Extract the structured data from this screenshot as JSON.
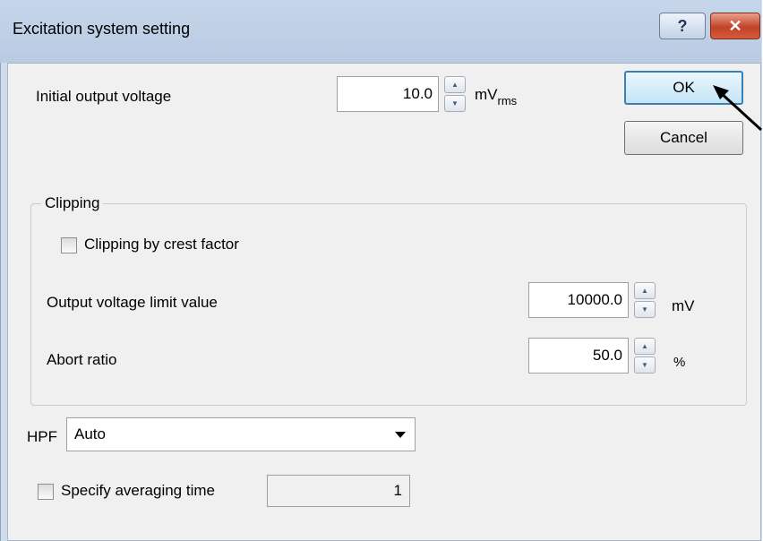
{
  "window": {
    "title": "Excitation system setting",
    "help_label": "?",
    "close_label": "✕"
  },
  "initial_output": {
    "label": "Initial output voltage",
    "value": "10.0",
    "unit_main": "mV",
    "unit_sub": "rms"
  },
  "buttons": {
    "ok": "OK",
    "cancel": "Cancel"
  },
  "clipping": {
    "group_title": "Clipping",
    "crest_label": "Clipping by crest factor",
    "crest_checked": false,
    "limit_label": "Output voltage limit value",
    "limit_value": "10000.0",
    "limit_unit": "mV",
    "abort_label": "Abort ratio",
    "abort_value": "50.0",
    "abort_unit": "%"
  },
  "hpf": {
    "label": "HPF",
    "selected": "Auto"
  },
  "averaging": {
    "label": "Specify averaging time",
    "checked": false,
    "value": "1"
  },
  "icons": {
    "spin_up": "▲",
    "spin_down": "▼"
  }
}
